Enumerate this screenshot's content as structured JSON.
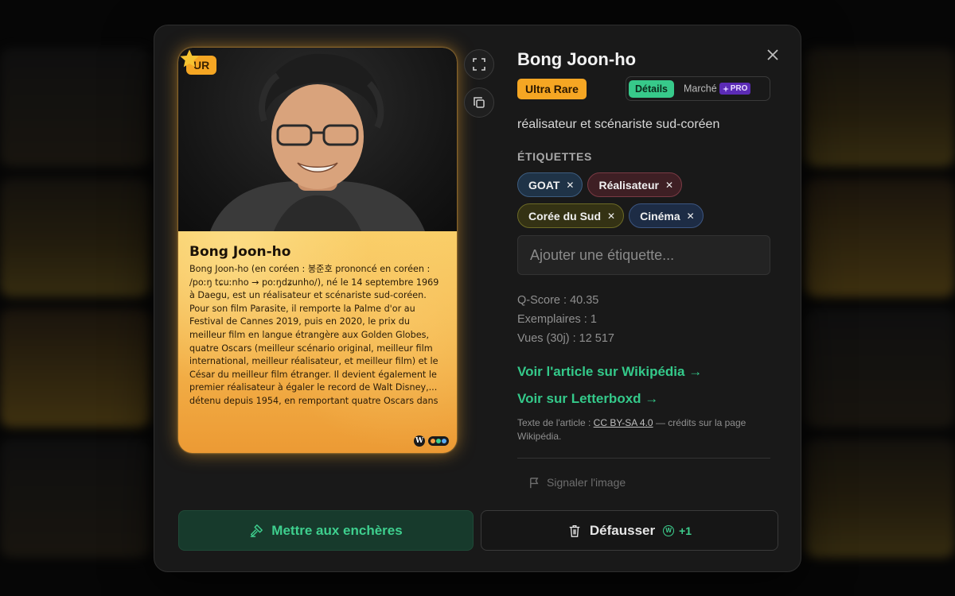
{
  "card": {
    "rarity_badge": "UR",
    "name": "Bong Joon-ho",
    "description": "Bong Joon-ho (en coréen : 봉준호 prononcé en coréen : /poːŋ tɕuːnho → poːŋdʑunho/), né le 14 septembre 1969 à Daegu, est un réalisateur et scénariste sud-coréen. Pour son film Parasite, il remporte la Palme d'or au Festival de Cannes 2019, puis en 2020, le prix du meilleur film en langue étrangère aux Golden Globes, quatre Oscars (meilleur scénario original, meilleur film international, meilleur réalisateur, et meilleur film) et le César du meilleur film étranger. Il devient également le premier réalisateur à égaler le record de Walt Disney,... détenu depuis 1954, en remportant quatre Oscars dans",
    "wiki_mark": "W"
  },
  "detail": {
    "title": "Bong Joon-ho",
    "rarity_label": "Ultra Rare",
    "tabs": [
      {
        "label": "Détails",
        "active": true
      },
      {
        "label": "Marché",
        "active": false
      }
    ],
    "pro_label": "PRO",
    "subtitle": "réalisateur et scénariste sud-coréen",
    "tags_heading": "ÉTIQUETTES",
    "tags": [
      "GOAT",
      "Réalisateur",
      "Corée du Sud",
      "Cinéma"
    ],
    "tag_input_placeholder": "Ajouter une étiquette...",
    "stats": {
      "qscore": "Q-Score : 40.35",
      "copies": "Exemplaires : 1",
      "views": "Vues (30j) : 12 517"
    },
    "links": {
      "wikipedia": "Voir l'article sur Wikipédia →",
      "letterboxd": "Voir sur Letterboxd →"
    },
    "credits": {
      "prefix": "Texte de l'article : ",
      "license": "CC BY-SA 4.0",
      "suffix": " — crédits sur la page Wikipédia."
    },
    "report_label": "Signaler l'image"
  },
  "actions": {
    "auction_label": "Mettre aux enchères",
    "discard_label": "Défausser",
    "discard_reward": "+1",
    "coin_mark": "W"
  },
  "colors": {
    "accent_green": "#34c98a",
    "rarity_orange": "#f5a623",
    "pro_purple": "#5b2bb5"
  },
  "icons": [
    "star-icon",
    "expand-icon",
    "copy-icon",
    "close-icon",
    "flag-icon",
    "gavel-icon",
    "trash-icon",
    "coin-icon",
    "wikipedia-icon"
  ]
}
